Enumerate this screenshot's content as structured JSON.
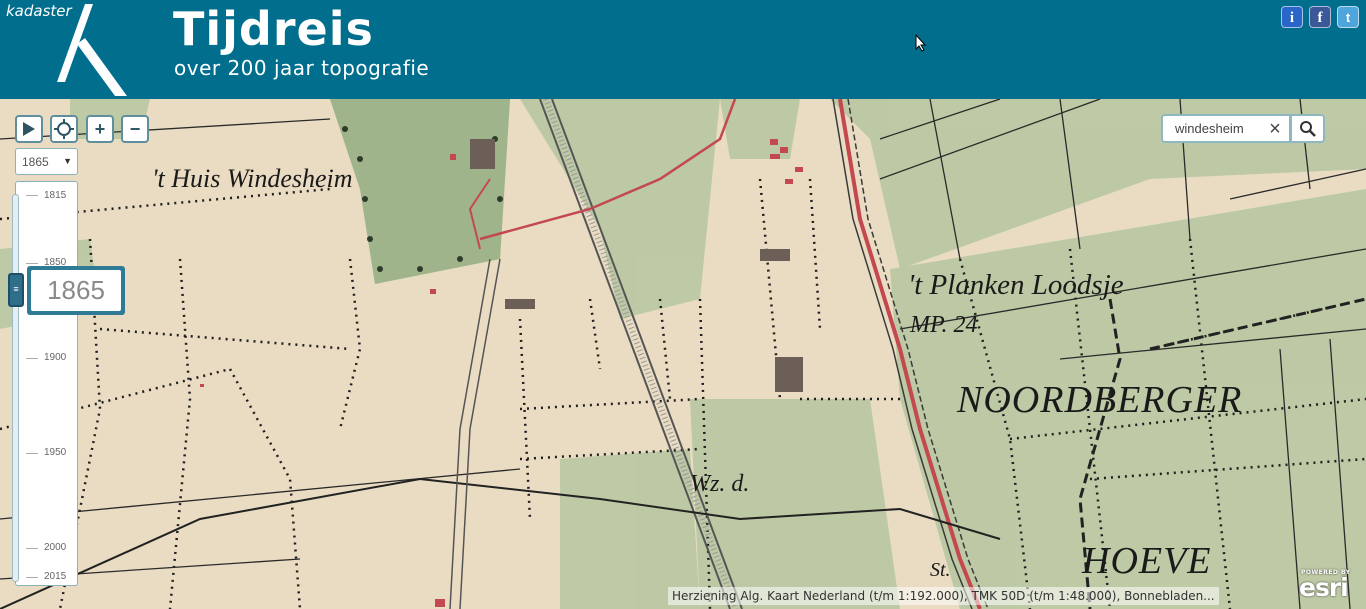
{
  "header": {
    "brand": "kadaster",
    "title": "Tijdreis",
    "subtitle": "over 200 jaar topografie",
    "social": {
      "info": "i",
      "facebook": "f",
      "twitter": "t"
    }
  },
  "controls": {
    "play_icon": "play-icon",
    "locate_icon": "crosshair-icon",
    "zoom_in": "+",
    "zoom_out": "−"
  },
  "year_select": {
    "value": "1865"
  },
  "timeline": {
    "labels": [
      "1815",
      "1850",
      "1900",
      "1950",
      "2000",
      "2015"
    ],
    "current_year": "1865"
  },
  "search": {
    "value": "windesheim",
    "clear": "×"
  },
  "map_labels": {
    "huis": "'t Huis Windesheim",
    "planken": "'t Planken Loodsje",
    "mp": "MP. 24",
    "noordberger": "NOORDBERGER",
    "hoeve": "HOEVE",
    "wzd": "Wz. d.",
    "st": "St."
  },
  "attribution": "Herziening Alg. Kaart Nederland (t/m 1:192.000), TMK 50D (t/m 1:48.000), Bonnebladen...",
  "esri": {
    "powered": "POWERED BY",
    "logo": "esri"
  },
  "colors": {
    "header": "#006e8c",
    "paper": "#e9dcc2",
    "meadow": "#b9c8a2",
    "road": "#c4484f"
  }
}
